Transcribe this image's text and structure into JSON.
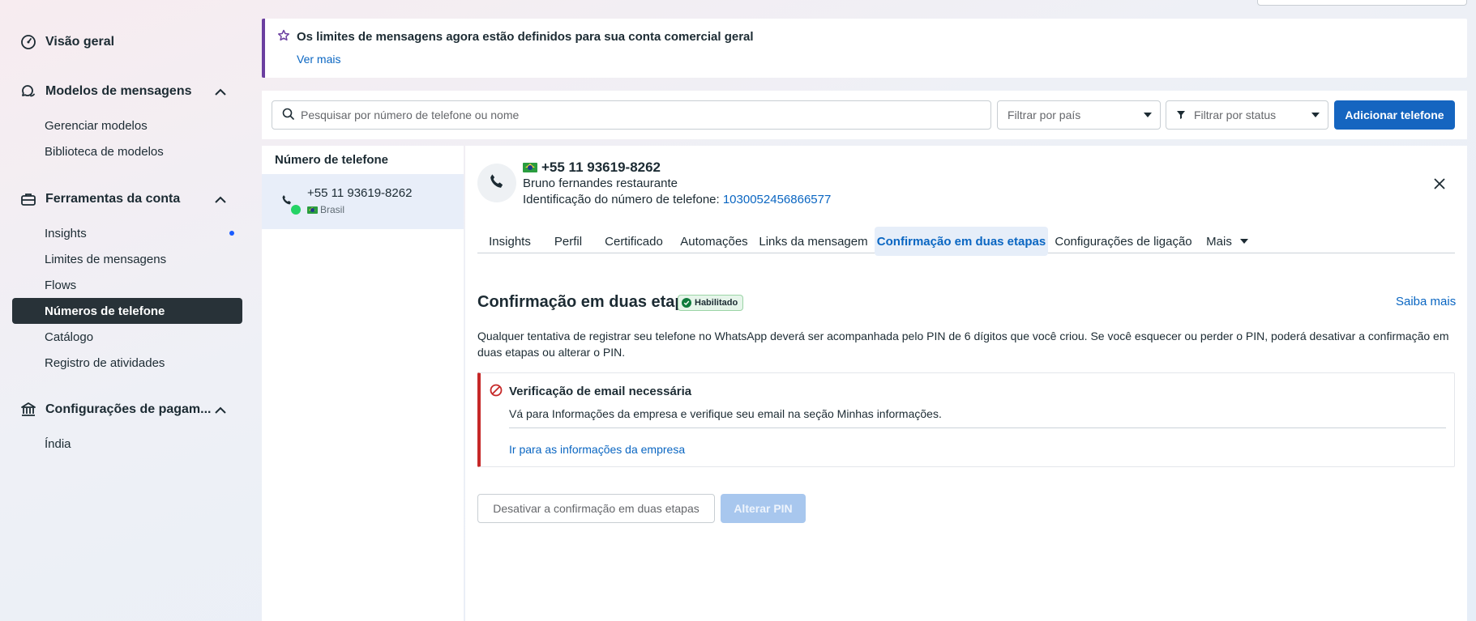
{
  "sidebar": {
    "overview": "Visão geral",
    "templates_group": "Modelos de mensagens",
    "manage_templates": "Gerenciar modelos",
    "template_library": "Biblioteca de modelos",
    "account_tools_group": "Ferramentas da conta",
    "insights": "Insights",
    "message_limits": "Limites de mensagens",
    "flows": "Flows",
    "phone_numbers": "Números de telefone",
    "catalog": "Catálogo",
    "activity_log": "Registro de atividades",
    "payment_group": "Configurações de pagam...",
    "india": "Índia"
  },
  "banner": {
    "title": "Os limites de mensagens agora estão definidos para sua conta comercial geral",
    "link": "Ver mais"
  },
  "toolbar": {
    "search_placeholder": "Pesquisar por número de telefone ou nome",
    "filter_country": "Filtrar por país",
    "filter_status": "Filtrar por status",
    "add_phone": "Adicionar telefone"
  },
  "list": {
    "header": "Número de telefone",
    "items": [
      {
        "number": "+55 11 93619-8262",
        "country": "Brasil"
      }
    ]
  },
  "detail": {
    "number": "+55 11 93619-8262",
    "name": "Bruno fernandes restaurante",
    "id_label": "Identificação do número de telefone:",
    "id_value": "1030052456866577",
    "tabs": [
      "Insights",
      "Perfil",
      "Certificado",
      "Automações",
      "Links da mensagem",
      "Confirmação em duas etapas",
      "Configurações de ligação",
      "Mais"
    ],
    "active_tab": "Confirmação em duas etapas",
    "section_title": "Confirmação em duas etapas",
    "status_badge": "Habilitado",
    "learn_more": "Saiba mais",
    "description": "Qualquer tentativa de registrar seu telefone no WhatsApp deverá ser acompanhada pelo PIN de 6 dígitos que você criou. Se você esquecer ou perder o PIN, poderá desativar a confirmação em duas etapas ou alterar o PIN.",
    "alert": {
      "title": "Verificação de email necessária",
      "text": "Vá para Informações da empresa e verifique seu email na seção Minhas informações.",
      "link": "Ir para as informações da empresa"
    },
    "disable_button": "Desativar a confirmação em duas etapas",
    "change_pin_button": "Alterar PIN"
  },
  "colors": {
    "primary": "#1565c0",
    "link": "#0a66c2",
    "active_nav": "#283238",
    "alert_border": "#c62828",
    "banner_accent": "#6b3fa0",
    "success": "#0f7b3c"
  }
}
